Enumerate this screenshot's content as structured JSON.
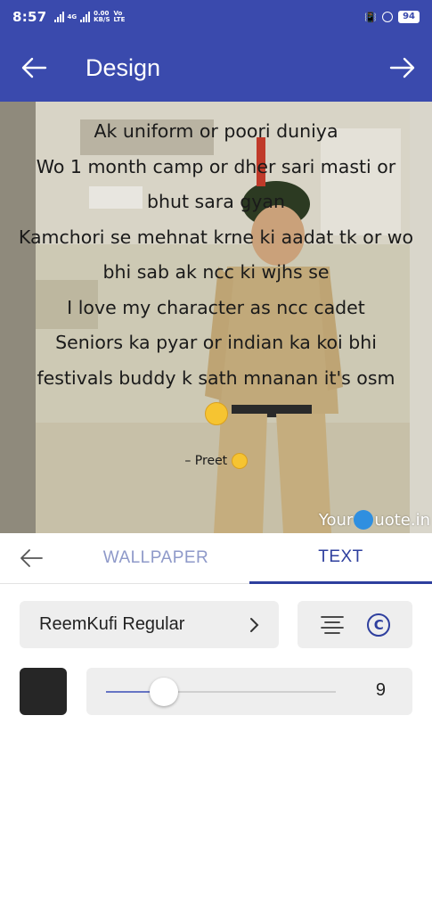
{
  "status_bar": {
    "time": "8:57",
    "net_label_top": "0.00",
    "net_label_bottom": "KB/S",
    "volte_top": "Vo",
    "volte_bottom": "LTE",
    "battery": "94",
    "net_gen": "4G"
  },
  "app_bar": {
    "title": "Design",
    "back_icon": "arrow-left-icon",
    "next_icon": "arrow-right-icon"
  },
  "preview": {
    "quote_lines": [
      "Ak uniform or poori duniya",
      "Wo 1 month camp or dher sari masti or",
      "bhut sara gyan",
      "Kamchori se mehnat krne ki aadat tk or wo",
      "bhi sab ak ncc ki wjhs se",
      "I love my character as ncc cadet",
      "Seniors ka pyar or indian ka koi bhi",
      "festivals buddy k sath mnanan it's osm"
    ],
    "author": "– Preet",
    "watermark_pre": "Your",
    "watermark_post": "uote.in"
  },
  "tabs": {
    "back_icon": "arrow-left-icon",
    "wallpaper": "WALLPAPER",
    "text": "TEXT",
    "active": "TEXT",
    "active_color": "#2e3f9e"
  },
  "font_select": {
    "value": "ReemKufi Regular",
    "chevron": "chevron-right-icon"
  },
  "align_icon": "align-center-icon",
  "copyright_glyph": "C",
  "text_color": "#262626",
  "size": {
    "value": "9",
    "fraction": 0.25
  },
  "accent": "#3a4aad"
}
